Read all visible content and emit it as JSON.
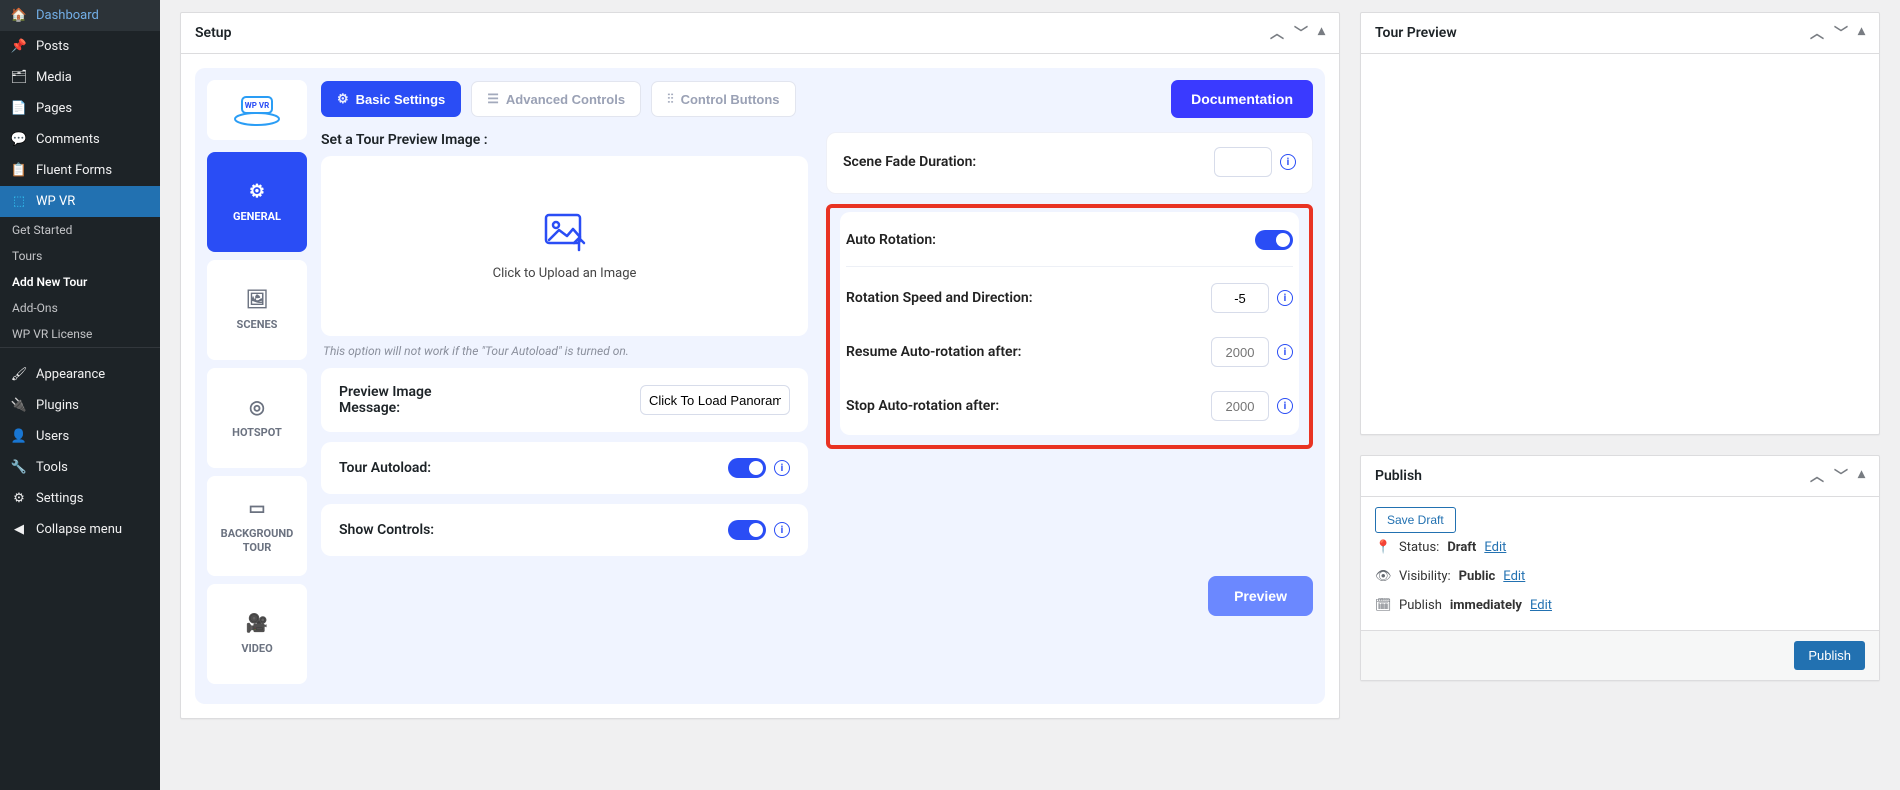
{
  "sidebar": {
    "items": [
      {
        "label": "Dashboard",
        "icon": "🏠"
      },
      {
        "label": "Posts",
        "icon": "📌"
      },
      {
        "label": "Media",
        "icon": "🗂"
      },
      {
        "label": "Pages",
        "icon": "📄"
      },
      {
        "label": "Comments",
        "icon": "💬"
      },
      {
        "label": "Fluent Forms",
        "icon": "📋"
      },
      {
        "label": "WP VR",
        "icon": "🥽"
      }
    ],
    "sub_items": [
      {
        "label": "Get Started"
      },
      {
        "label": "Tours"
      },
      {
        "label": "Add New Tour",
        "current": true
      },
      {
        "label": "Add-Ons"
      },
      {
        "label": "WP VR License"
      }
    ],
    "items2": [
      {
        "label": "Appearance",
        "icon": "🖌"
      },
      {
        "label": "Plugins",
        "icon": "🔌"
      },
      {
        "label": "Users",
        "icon": "👤"
      },
      {
        "label": "Tools",
        "icon": "🔧"
      },
      {
        "label": "Settings",
        "icon": "⚙"
      },
      {
        "label": "Collapse menu",
        "icon": "◀"
      }
    ]
  },
  "setup": {
    "title": "Setup",
    "tabs": {
      "basic": "Basic Settings",
      "advanced": "Advanced Controls",
      "control": "Control Buttons",
      "doc": "Documentation"
    },
    "vtabs": {
      "general": "GENERAL",
      "scenes": "SCENES",
      "hotspot": "HOTSPOT",
      "background": "BACKGROUND TOUR",
      "video": "VIDEO"
    },
    "left": {
      "set_preview_label": "Set a Tour Preview Image :",
      "upload_hint": "Click to Upload an Image",
      "autoload_note": "This option will not work if the \"Tour Autoload\" is turned on.",
      "preview_msg_label": "Preview Image Message:",
      "preview_msg_value": "Click To Load Panoram",
      "autoload_label": "Tour Autoload:",
      "show_controls_label": "Show Controls:"
    },
    "right": {
      "fade_label": "Scene Fade Duration:",
      "fade_value": "",
      "auto_rotation_label": "Auto Rotation:",
      "speed_label": "Rotation Speed and Direction:",
      "speed_value": "-5",
      "resume_label": "Resume Auto-rotation after:",
      "resume_placeholder": "2000",
      "stop_label": "Stop Auto-rotation after:",
      "stop_placeholder": "2000"
    },
    "preview_btn": "Preview"
  },
  "tour_preview": {
    "title": "Tour Preview"
  },
  "publish": {
    "title": "Publish",
    "save_draft": "Save Draft",
    "status_label": "Status:",
    "status_value": "Draft",
    "visibility_label": "Visibility:",
    "visibility_value": "Public",
    "publish_label": "Publish",
    "publish_value": "immediately",
    "edit": "Edit",
    "publish_btn": "Publish"
  }
}
